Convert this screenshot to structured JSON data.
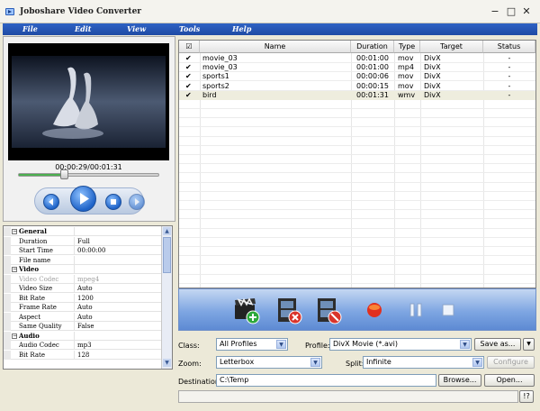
{
  "window": {
    "title": "Joboshare Video Converter",
    "minimize_glyph": "−",
    "maximize_glyph": "□",
    "close_glyph": "✕"
  },
  "menu": {
    "items": [
      "File",
      "Edit",
      "View",
      "Tools",
      "Help"
    ]
  },
  "player": {
    "time": "00:00:29/00:01:31",
    "progress": 0.32,
    "buttons": [
      "previous-icon",
      "play-icon",
      "stop-icon",
      "next-icon"
    ]
  },
  "properties": {
    "rows": [
      {
        "key": "General",
        "val": "",
        "category": true
      },
      {
        "key": "Duration",
        "val": "Full"
      },
      {
        "key": "Start Time",
        "val": "00:00:00"
      },
      {
        "key": "File name",
        "val": ""
      },
      {
        "key": "Video",
        "val": "",
        "category": true
      },
      {
        "key": "Video Codec",
        "val": "mpeg4",
        "disabled": true
      },
      {
        "key": "Video Size",
        "val": "Auto"
      },
      {
        "key": "Bit Rate",
        "val": "1200"
      },
      {
        "key": "Frame Rate",
        "val": "Auto"
      },
      {
        "key": "Aspect",
        "val": "Auto"
      },
      {
        "key": "Same Quality",
        "val": "False"
      },
      {
        "key": "Audio",
        "val": "",
        "category": true
      },
      {
        "key": "Audio Codec",
        "val": "mp3"
      },
      {
        "key": "Bit Rate",
        "val": "128"
      }
    ]
  },
  "file_list": {
    "columns": {
      "name": "Name",
      "duration": "Duration",
      "type": "Type",
      "target": "Target",
      "status": "Status"
    },
    "rows": [
      {
        "checked": true,
        "name": "movie_03",
        "duration": "00:01:00",
        "type": "mov",
        "target": "DivX",
        "status": "-"
      },
      {
        "checked": true,
        "name": "movie_03",
        "duration": "00:01:00",
        "type": "mp4",
        "target": "DivX",
        "status": "-"
      },
      {
        "checked": true,
        "name": "sports1",
        "duration": "00:00:06",
        "type": "mov",
        "target": "DivX",
        "status": "-"
      },
      {
        "checked": true,
        "name": "sports2",
        "duration": "00:00:15",
        "type": "mov",
        "target": "DivX",
        "status": "-"
      },
      {
        "checked": true,
        "name": "bird",
        "duration": "00:01:31",
        "type": "wmv",
        "target": "DivX",
        "status": "-",
        "selected": true
      }
    ]
  },
  "toolbar": {
    "icons": [
      "add-video-icon",
      "remove-video-icon",
      "clear-list-icon",
      "record-icon",
      "pause-icon",
      "stop-icon"
    ]
  },
  "settings": {
    "class_label": "Class:",
    "class_value": "All Profiles",
    "profile_label": "Profile:",
    "profile_value": "DivX Movie  (*.avi)",
    "save_as": "Save as...",
    "zoom_label": "Zoom:",
    "zoom_value": "Letterbox",
    "split_label": "Split:",
    "split_value": "Infinite",
    "configure": "Configure",
    "destination_label": "Destination:",
    "destination_value": "C:\\Temp",
    "browse": "Browse...",
    "open": "Open...",
    "help": "!?"
  },
  "colors": {
    "menubar": "#1f4aa4",
    "toolbar": "#7ea6e2",
    "accent_red": "#d9342b",
    "selection": "#eeedde"
  }
}
